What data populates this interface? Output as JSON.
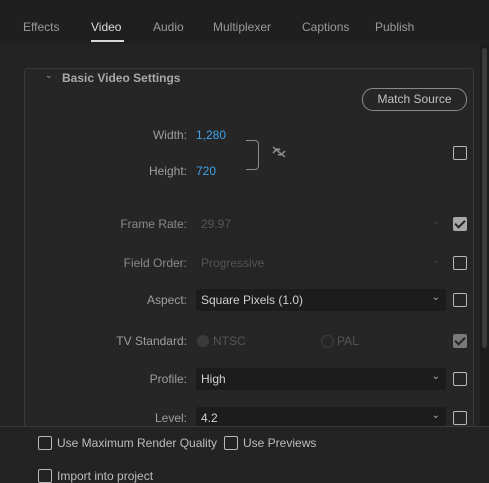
{
  "tabs": {
    "effects": "Effects",
    "video": "Video",
    "audio": "Audio",
    "multiplexer": "Multiplexer",
    "captions": "Captions",
    "publish": "Publish",
    "active": "Video"
  },
  "section": {
    "title": "Basic Video Settings",
    "match_source": "Match Source"
  },
  "fields": {
    "width": {
      "label": "Width:",
      "value": "1,280"
    },
    "height": {
      "label": "Height:",
      "value": "720"
    },
    "frame_rate": {
      "label": "Frame Rate:",
      "value": "29.97",
      "enabled": false,
      "match_checked": true
    },
    "field_order": {
      "label": "Field Order:",
      "value": "Progressive",
      "enabled": false,
      "match_checked": false
    },
    "aspect": {
      "label": "Aspect:",
      "value": "Square Pixels (1.0)",
      "match_checked": false
    },
    "tv_standard": {
      "label": "TV Standard:",
      "option_ntsc": "NTSC",
      "option_pal": "PAL",
      "selected": "NTSC",
      "enabled": false,
      "match_checked": true
    },
    "profile": {
      "label": "Profile:",
      "value": "High",
      "match_checked": false
    },
    "level": {
      "label": "Level:",
      "value": "4.2",
      "match_checked": false
    }
  },
  "bottom": {
    "max_render_quality": "Use Maximum Render Quality",
    "use_previews": "Use Previews",
    "import_into_project": "Import into project"
  },
  "colors": {
    "background": "#232323",
    "accent_link": "#3fa2e8"
  },
  "icons": {
    "link": "chain-unlink-icon",
    "chevron": "chevron-down-icon"
  }
}
